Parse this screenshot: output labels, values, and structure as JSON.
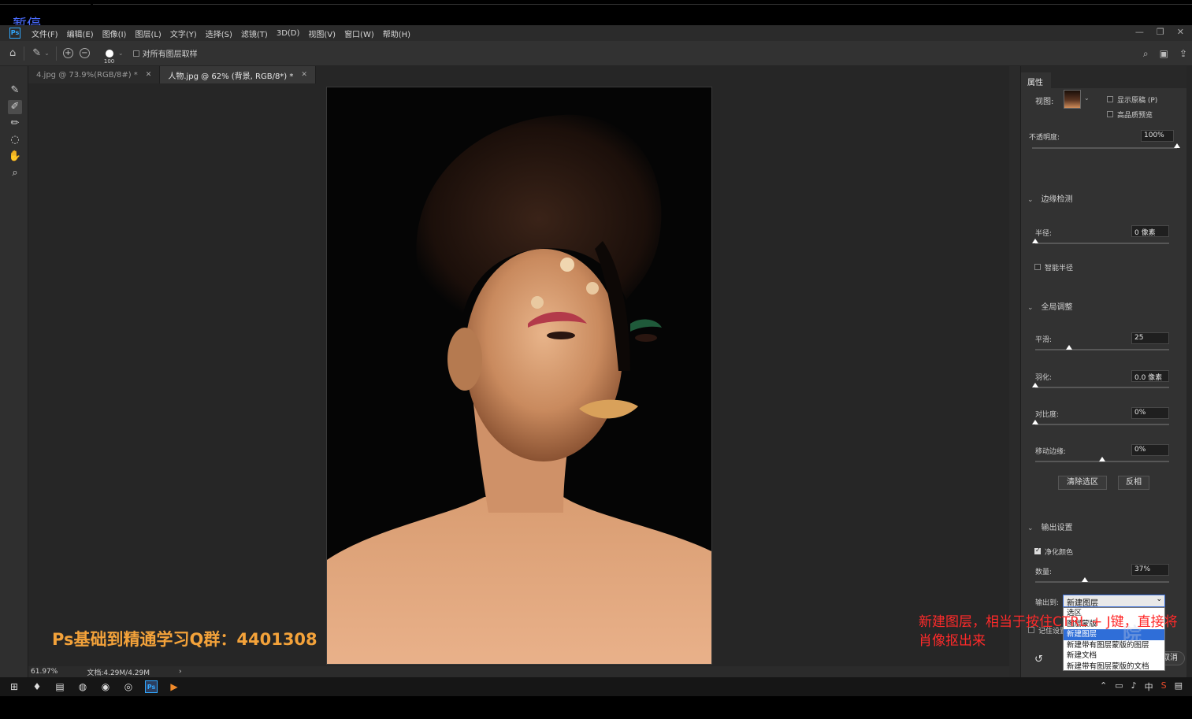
{
  "overlay": {
    "pause": "暂停"
  },
  "app": {
    "logo": "Ps"
  },
  "menu": [
    "文件(F)",
    "编辑(E)",
    "图像(I)",
    "图层(L)",
    "文字(Y)",
    "选择(S)",
    "滤镜(T)",
    "3D(D)",
    "视图(V)",
    "窗口(W)",
    "帮助(H)"
  ],
  "options": {
    "brush_size": "100",
    "sample_all_layers": "对所有图层取样"
  },
  "tabs": [
    {
      "label": "4.jpg @ 73.9%(RGB/8#) *"
    },
    {
      "label": "人物.jpg @ 62% (背景, RGB/8*) *"
    }
  ],
  "canvas": {
    "promo_text": "Ps基础到精通学习Q群：4401308"
  },
  "status": {
    "zoom": "61.97%",
    "doc": "文档:4.29M/4.29M",
    "arrow": "›"
  },
  "panel": {
    "tab": "属性",
    "view_label": "视图:",
    "show_original": "显示原稿 (P)",
    "high_quality": "高品质预览",
    "opacity_label": "不透明度:",
    "opacity_value": "100%",
    "edge_detection": {
      "title": "边缘检测",
      "radius_label": "半径:",
      "radius_value": "0 像素",
      "smart_radius": "智能半径"
    },
    "global": {
      "title": "全局调整",
      "smooth_label": "平滑:",
      "smooth_value": "25",
      "feather_label": "羽化:",
      "feather_value": "0.0 像素",
      "contrast_label": "对比度:",
      "contrast_value": "0%",
      "shift_label": "移动边缘:",
      "shift_value": "0%",
      "clear_button": "清除选区",
      "invert_button": "反相"
    },
    "output": {
      "title": "输出设置",
      "decontaminate": "净化颜色",
      "amount_label": "数量:",
      "amount_value": "37%",
      "output_to_label": "输出到:",
      "output_to_value": "新建图层",
      "remember": "记住设置",
      "cancel_button": "取消",
      "options": [
        "选区",
        "图层蒙版",
        "新建图层",
        "新建带有图层蒙版的图层",
        "新建文档",
        "新建带有图层蒙版的文档"
      ]
    },
    "levels": {
      "opacity": 1.0,
      "radius": 0.0,
      "smooth": 0.25,
      "feather": 0.0,
      "contrast": 0.0,
      "shift": 0.5,
      "amount": 0.37
    }
  },
  "annotation": {
    "line1": "新建图层，相当于按住CTRL + J键，直接将",
    "line2": "肖像抠出来"
  },
  "watermark": "院",
  "taskbar": {
    "ps_label": "Ps",
    "ime": "中"
  },
  "colors": {
    "accent": "#31a8ff",
    "annotation": "#ff2a2a",
    "promo": "#f3a23a",
    "dropdown_highlight": "#2f6ed8"
  }
}
